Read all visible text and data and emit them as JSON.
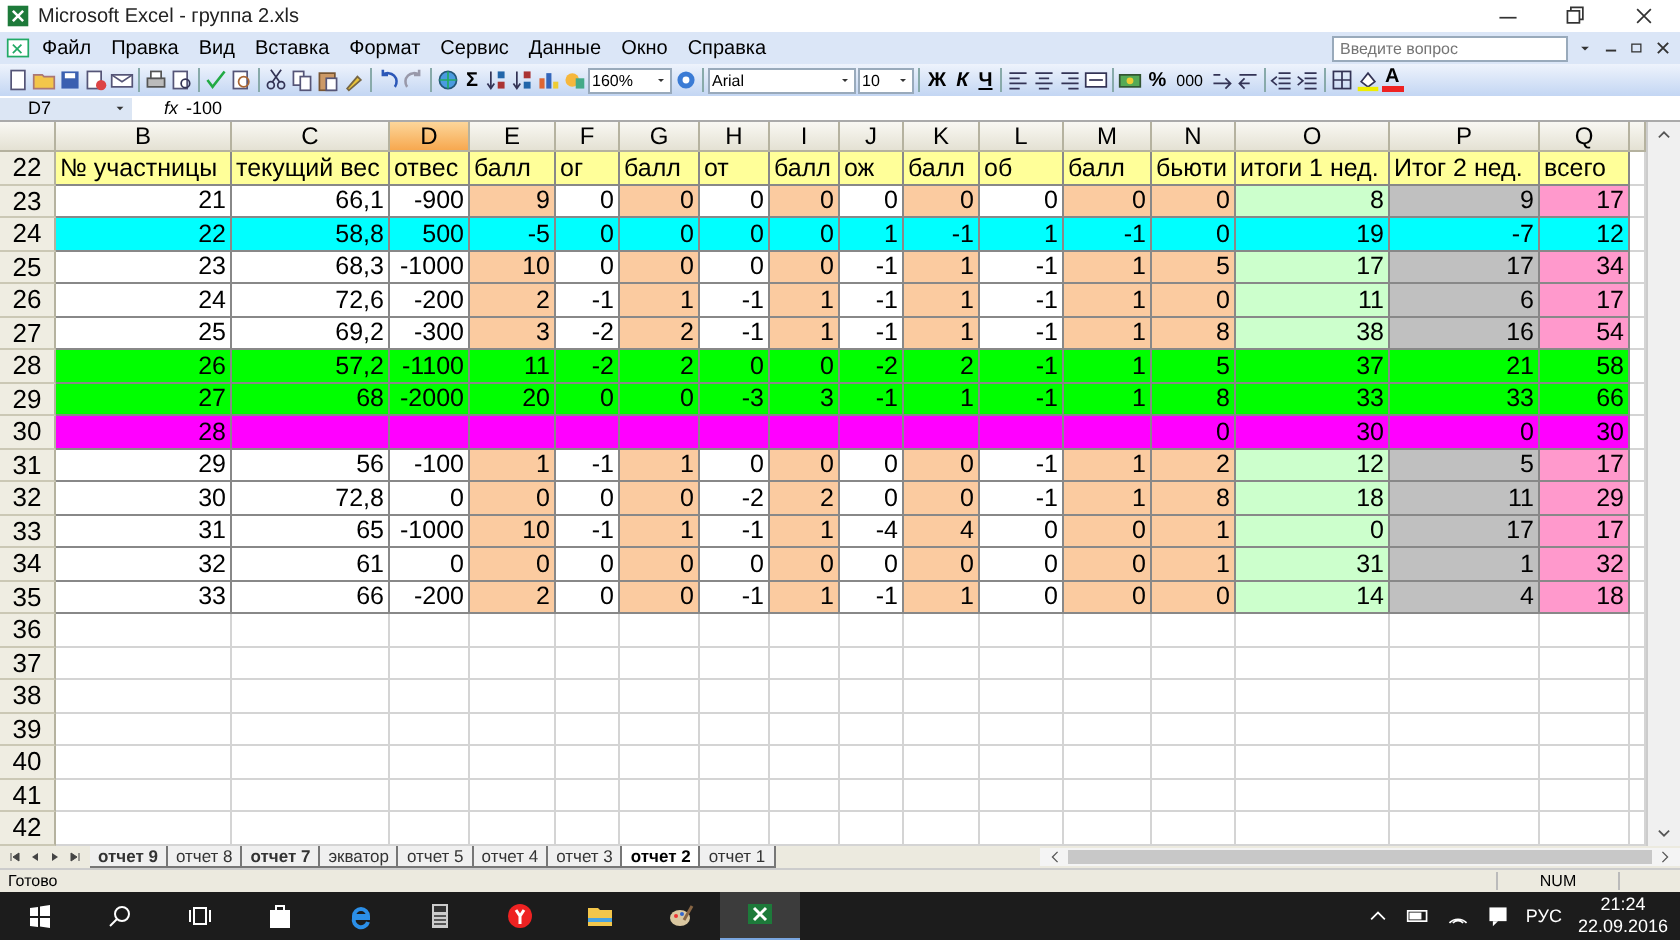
{
  "window": {
    "title": "Microsoft Excel - группа 2.xls"
  },
  "menu": [
    "Файл",
    "Правка",
    "Вид",
    "Вставка",
    "Формат",
    "Сервис",
    "Данные",
    "Окно",
    "Справка"
  ],
  "help_box": {
    "placeholder": "Введите вопрос"
  },
  "toolbar": {
    "sum": "Σ",
    "zoom": "160%",
    "font": "Arial",
    "font_size": "10",
    "bold": "Ж",
    "italic": "К",
    "underline": "Ч",
    "percent": "%",
    "thousands": "000",
    "font_color": "A"
  },
  "formula_bar": {
    "name_box": "D7",
    "fx": "fx",
    "value": "-100"
  },
  "columns": [
    {
      "letter": "B",
      "color": "#ffffff",
      "selected": false
    },
    {
      "letter": "C",
      "color": "#ffffff",
      "selected": false
    },
    {
      "letter": "D",
      "color": "#ffffff",
      "selected": true
    },
    {
      "letter": "E",
      "color": "#fbcba0",
      "selected": false
    },
    {
      "letter": "F",
      "color": "#ffffff",
      "selected": false
    },
    {
      "letter": "G",
      "color": "#fbcba0",
      "selected": false
    },
    {
      "letter": "H",
      "color": "#ffffff",
      "selected": false
    },
    {
      "letter": "I",
      "color": "#fbcba0",
      "selected": false
    },
    {
      "letter": "J",
      "color": "#ffffff",
      "selected": false
    },
    {
      "letter": "K",
      "color": "#fbcba0",
      "selected": false
    },
    {
      "letter": "L",
      "color": "#ffffff",
      "selected": false
    },
    {
      "letter": "M",
      "color": "#fbcba0",
      "selected": false
    },
    {
      "letter": "N",
      "color": "#fbcba0",
      "selected": false
    },
    {
      "letter": "O",
      "color": "#ccffcc",
      "selected": false
    },
    {
      "letter": "P",
      "color": "#c0c0c0",
      "selected": false
    },
    {
      "letter": "Q",
      "color": "#ff99cc",
      "selected": false
    }
  ],
  "header_row": {
    "number": "22",
    "color": "#ffff99",
    "cells": [
      "№ участницы",
      "текущий вес",
      "отвес",
      "балл",
      "ог",
      "балл",
      "от",
      "балл",
      "ож",
      "балл",
      "об",
      "балл",
      "бьюти",
      "итоги 1 нед.",
      "Итог 2 нед.",
      "всего"
    ]
  },
  "rows": [
    {
      "number": "23",
      "cells": [
        "21",
        "66,1",
        "-900",
        "9",
        "0",
        "0",
        "0",
        "0",
        "0",
        "0",
        "0",
        "0",
        "0",
        "8",
        "9",
        "17"
      ]
    },
    {
      "number": "24",
      "color": "#00ffff",
      "cells": [
        "22",
        "58,8",
        "500",
        "-5",
        "0",
        "0",
        "0",
        "0",
        "1",
        "-1",
        "1",
        "-1",
        "0",
        "19",
        "-7",
        "12"
      ]
    },
    {
      "number": "25",
      "cells": [
        "23",
        "68,3",
        "-1000",
        "10",
        "0",
        "0",
        "0",
        "0",
        "-1",
        "1",
        "-1",
        "1",
        "5",
        "17",
        "17",
        "34"
      ]
    },
    {
      "number": "26",
      "cells": [
        "24",
        "72,6",
        "-200",
        "2",
        "-1",
        "1",
        "-1",
        "1",
        "-1",
        "1",
        "-1",
        "1",
        "0",
        "11",
        "6",
        "17"
      ]
    },
    {
      "number": "27",
      "cells": [
        "25",
        "69,2",
        "-300",
        "3",
        "-2",
        "2",
        "-1",
        "1",
        "-1",
        "1",
        "-1",
        "1",
        "8",
        "38",
        "16",
        "54"
      ]
    },
    {
      "number": "28",
      "color": "#00ff00",
      "cells": [
        "26",
        "57,2",
        "-1100",
        "11",
        "-2",
        "2",
        "0",
        "0",
        "-2",
        "2",
        "-1",
        "1",
        "5",
        "37",
        "21",
        "58"
      ]
    },
    {
      "number": "29",
      "color": "#00ff00",
      "cells": [
        "27",
        "68",
        "-2000",
        "20",
        "0",
        "0",
        "-3",
        "3",
        "-1",
        "1",
        "-1",
        "1",
        "8",
        "33",
        "33",
        "66"
      ]
    },
    {
      "number": "30",
      "color": "#ff00ff",
      "cells": [
        "28",
        null,
        null,
        null,
        null,
        null,
        null,
        null,
        null,
        null,
        null,
        null,
        "0",
        "30",
        "0",
        "30"
      ]
    },
    {
      "number": "31",
      "cells": [
        "29",
        "56",
        "-100",
        "1",
        "-1",
        "1",
        "0",
        "0",
        "0",
        "0",
        "-1",
        "1",
        "2",
        "12",
        "5",
        "17"
      ]
    },
    {
      "number": "32",
      "cells": [
        "30",
        "72,8",
        "0",
        "0",
        "0",
        "0",
        "-2",
        "2",
        "0",
        "0",
        "-1",
        "1",
        "8",
        "18",
        "11",
        "29"
      ]
    },
    {
      "number": "33",
      "cells": [
        "31",
        "65",
        "-1000",
        "10",
        "-1",
        "1",
        "-1",
        "1",
        "-4",
        "4",
        "0",
        "0",
        "1",
        "0",
        "17",
        "17"
      ]
    },
    {
      "number": "34",
      "cells": [
        "32",
        "61",
        "0",
        "0",
        "0",
        "0",
        "0",
        "0",
        "0",
        "0",
        "0",
        "0",
        "1",
        "31",
        "1",
        "32"
      ]
    },
    {
      "number": "35",
      "cells": [
        "33",
        "66",
        "-200",
        "2",
        "0",
        "0",
        "-1",
        "1",
        "-1",
        "1",
        "0",
        "0",
        "0",
        "14",
        "4",
        "18"
      ]
    },
    {
      "number": "36"
    },
    {
      "number": "37"
    },
    {
      "number": "38"
    },
    {
      "number": "39"
    },
    {
      "number": "40"
    },
    {
      "number": "41"
    },
    {
      "number": "42"
    }
  ],
  "sheet_tabs": [
    {
      "label": "отчет 9",
      "bold": true,
      "selected": false
    },
    {
      "label": "отчет 8",
      "bold": false,
      "selected": false
    },
    {
      "label": "отчет 7",
      "bold": true,
      "selected": false
    },
    {
      "label": "экватор",
      "bold": false,
      "selected": false
    },
    {
      "label": "отчет 5",
      "bold": false,
      "selected": false
    },
    {
      "label": "отчет 4",
      "bold": false,
      "selected": false
    },
    {
      "label": "отчет 3",
      "bold": false,
      "selected": false
    },
    {
      "label": "отчет 2",
      "bold": true,
      "selected": true
    },
    {
      "label": "отчет 1",
      "bold": false,
      "selected": false
    }
  ],
  "status_bar": {
    "status": "Готово",
    "num": "NUM"
  },
  "taskbar": {
    "language": "РУС",
    "time": "21:24",
    "date": "22.09.2016"
  }
}
